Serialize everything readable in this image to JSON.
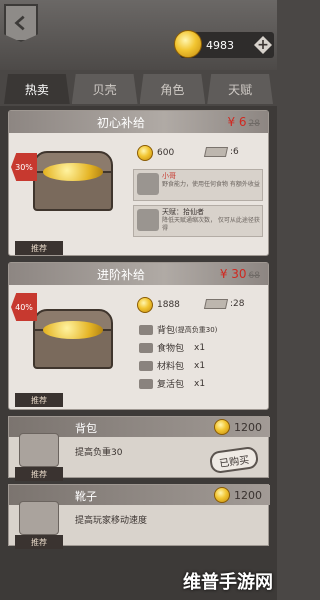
{
  "header": {
    "coins": "4983",
    "plus": "+"
  },
  "tabs": [
    {
      "label": "热卖"
    },
    {
      "label": "贝壳"
    },
    {
      "label": "角色"
    },
    {
      "label": "天赋"
    }
  ],
  "packs": [
    {
      "title": "初心补给",
      "price": "¥ 6",
      "old_price": "28",
      "discount": "30%",
      "ribbon": "推荐",
      "coins": "600",
      "tickets": "6",
      "info1_title": "小哥",
      "info1_desc": "野食能力，使用任何食物\n有额外收益",
      "info2_title": "天赋：拾仙者",
      "info2_desc": "降低天赋通缩次数，\n仅可从此途径获得"
    },
    {
      "title": "进阶补给",
      "price": "¥ 30",
      "old_price": "68",
      "discount": "40%",
      "ribbon": "推荐",
      "coins": "1888",
      "tickets": "28",
      "items": [
        {
          "name": "背包",
          "desc": "(提高负重30)",
          "count": ""
        },
        {
          "name": "食物包",
          "desc": "",
          "count": "x1"
        },
        {
          "name": "材料包",
          "desc": "",
          "count": "x1"
        },
        {
          "name": "复活包",
          "desc": "",
          "count": "x1"
        }
      ]
    }
  ],
  "shop_items": [
    {
      "name": "背包",
      "price": "1200",
      "desc": "提高负重30",
      "ribbon": "推荐",
      "button": "已购买"
    },
    {
      "name": "靴子",
      "price": "1200",
      "desc": "提高玩家移动速度",
      "ribbon": "推荐"
    }
  ],
  "watermark": "维普手游网",
  "colors": {
    "accent": "#d02820",
    "coin": "#f2c531"
  }
}
